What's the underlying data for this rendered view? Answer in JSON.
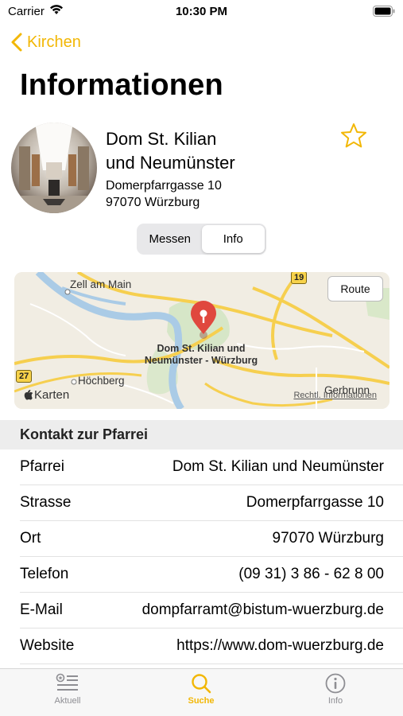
{
  "status_bar": {
    "carrier": "Carrier",
    "time": "10:30 PM"
  },
  "nav": {
    "back_label": "Kirchen"
  },
  "page_title": "Informationen",
  "church": {
    "name_line1": "Dom St. Kilian",
    "name_line2": "und Neumünster",
    "street": "Domerpfarrgasse 10",
    "city": "97070 Würzburg",
    "favorite_icon": "star-outline-icon"
  },
  "segmented": {
    "options": [
      "Messen",
      "Info"
    ],
    "selected": "Info"
  },
  "map": {
    "place_labels": {
      "zell": "Zell am Main",
      "hoechberg": "Höchberg",
      "gerbrunn": "Gerbrunn"
    },
    "pin_label_line1": "Dom St. Kilian und",
    "pin_label_line2": "Neumünster - Würzburg",
    "road_shields": {
      "b19": "19",
      "b27": "27"
    },
    "route_button": "Route",
    "maps_brand": "Karten",
    "legal": "Rechtl. Informationen",
    "accent_pin_color": "#e0483e"
  },
  "contact": {
    "header": "Kontakt zur Pfarrei",
    "rows": [
      {
        "label": "Pfarrei",
        "value": "Dom St. Kilian und Neumünster"
      },
      {
        "label": "Strasse",
        "value": "Domerpfarrgasse 10"
      },
      {
        "label": "Ort",
        "value": "97070 Würzburg"
      },
      {
        "label": "Telefon",
        "value": "(09 31) 3 86 - 62 8 00"
      },
      {
        "label": "E-Mail",
        "value": "dompfarramt@bistum-wuerzburg.de"
      },
      {
        "label": "Website",
        "value": "https://www.dom-wuerzburg.de"
      }
    ]
  },
  "tabbar": {
    "tabs": [
      {
        "label": "Aktuell",
        "icon": "news-list-icon"
      },
      {
        "label": "Suche",
        "icon": "search-icon",
        "active": true
      },
      {
        "label": "Info",
        "icon": "info-icon"
      }
    ]
  },
  "colors": {
    "accent": "#f2b705",
    "section_bg": "#ededed"
  }
}
